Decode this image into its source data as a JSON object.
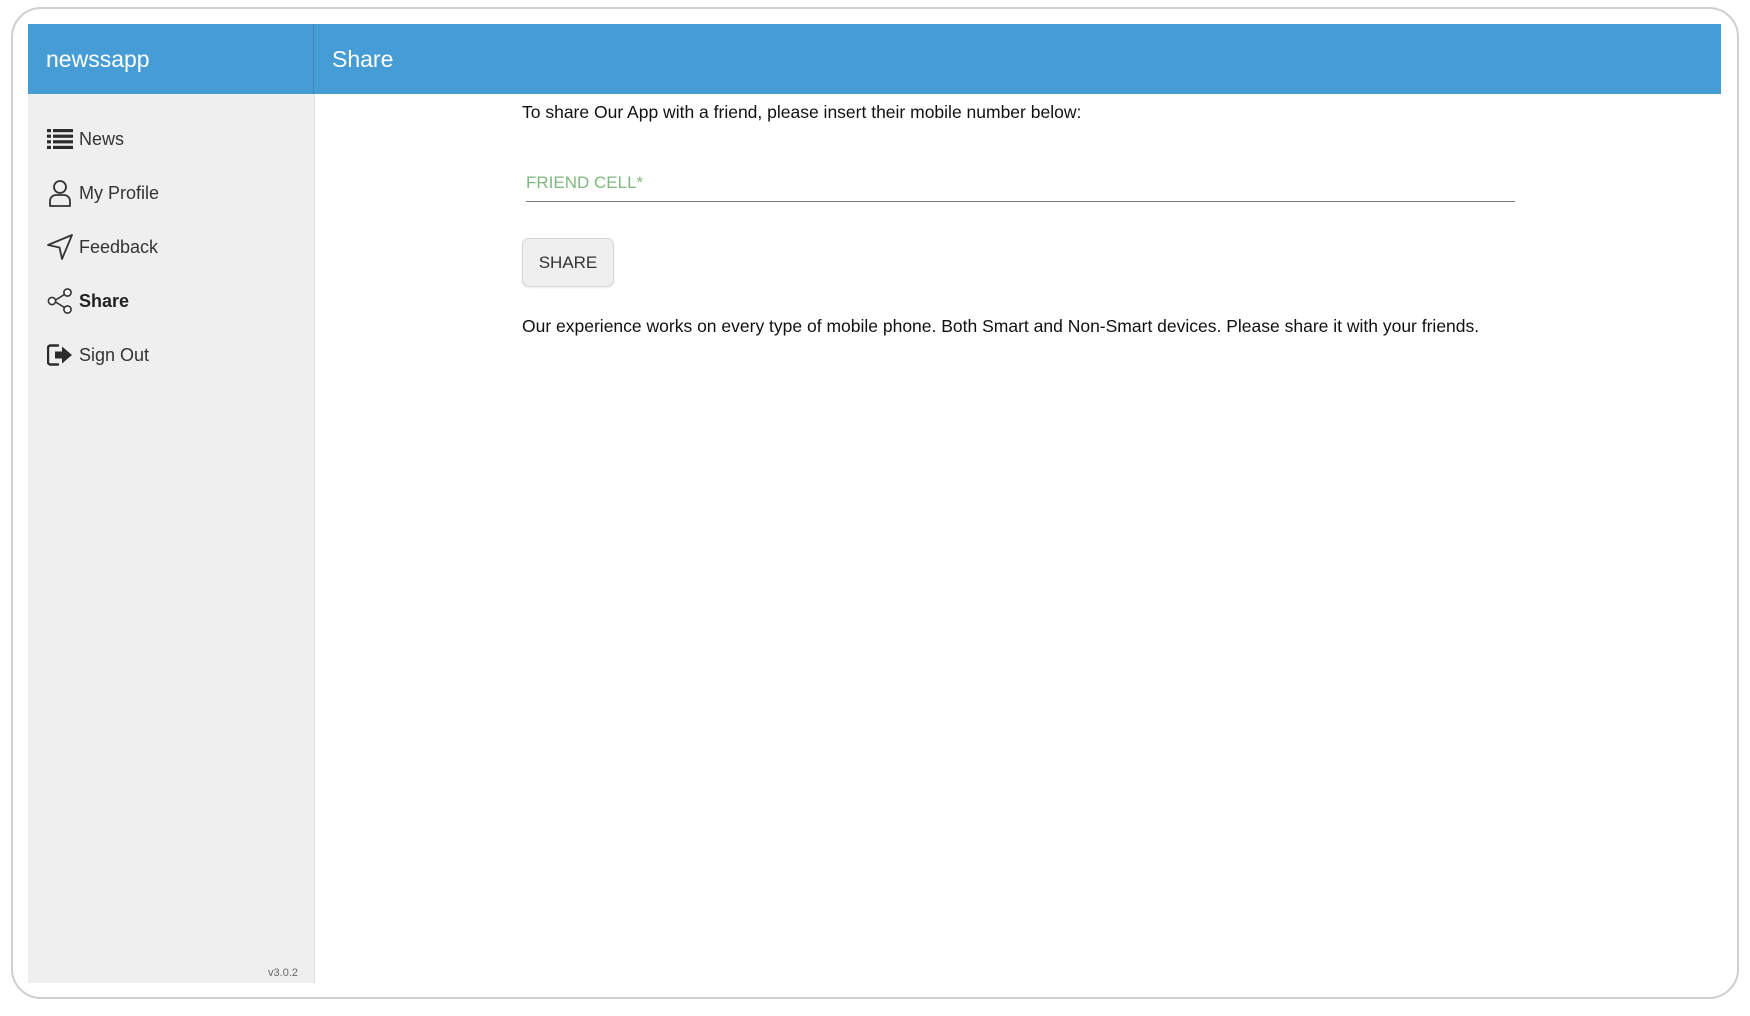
{
  "app": {
    "brand": "newssapp",
    "page_title": "Share",
    "version": "v3.0.2"
  },
  "colors": {
    "header": "#469dd6",
    "sidebar": "#efefef",
    "placeholder": "#7fb87f"
  },
  "sidebar": {
    "items": [
      {
        "label": "News",
        "icon": "list-icon",
        "active": false
      },
      {
        "label": "My Profile",
        "icon": "person-icon",
        "active": false
      },
      {
        "label": "Feedback",
        "icon": "send-icon",
        "active": false
      },
      {
        "label": "Share",
        "icon": "share-icon",
        "active": true
      },
      {
        "label": "Sign Out",
        "icon": "sign-out-icon",
        "active": false
      }
    ]
  },
  "main": {
    "intro": "To share Our App with a friend, please insert their mobile number below:",
    "friend_cell": {
      "value": "",
      "placeholder": "FRIEND CELL*"
    },
    "share_button": "SHARE",
    "note": "Our experience works on every type of mobile phone. Both Smart and Non-Smart devices. Please share it with your friends."
  }
}
